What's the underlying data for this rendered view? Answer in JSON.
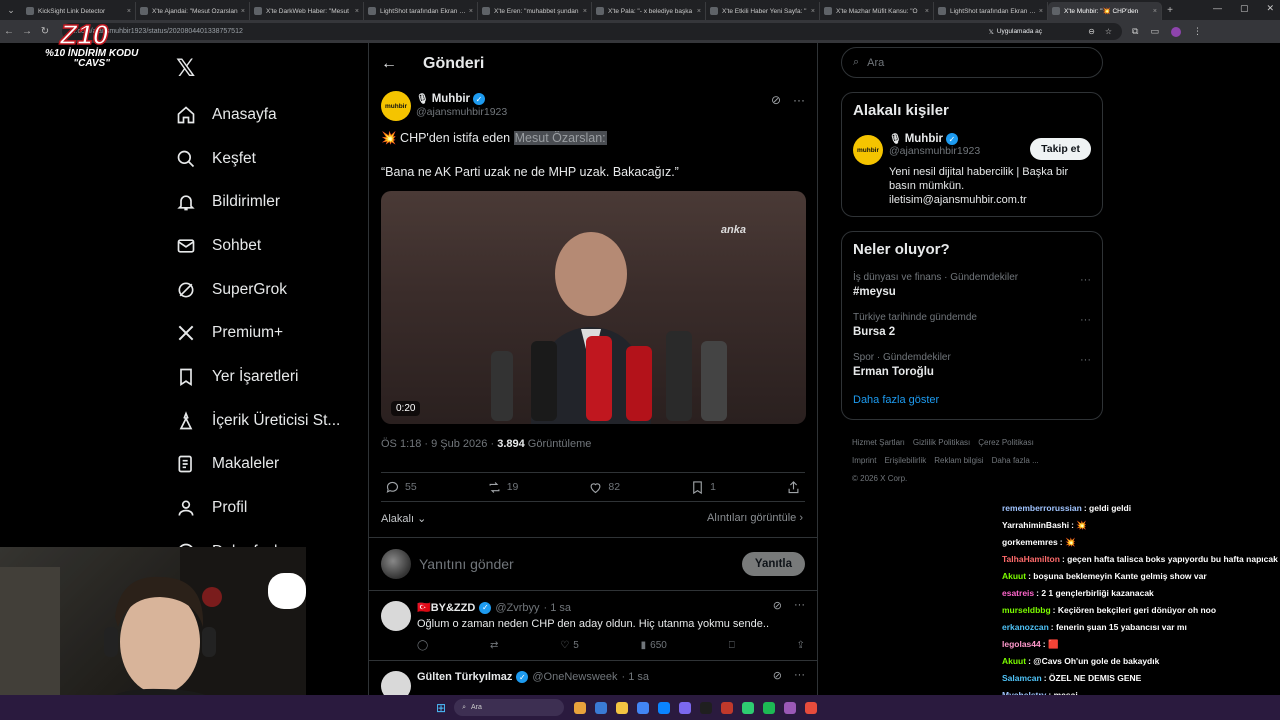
{
  "browser": {
    "tabs": [
      {
        "label": "KickSight Link Detector",
        "active": false
      },
      {
        "label": "X'te Ajandai: \"Mesut Özarslan",
        "active": false
      },
      {
        "label": "X'te DarkWeb Haber: \"Mesut",
        "active": false
      },
      {
        "label": "LightShot tarafından Ekran Gö",
        "active": false
      },
      {
        "label": "X'te Eren: \"muhabbet şundan",
        "active": false
      },
      {
        "label": "X'te Pala: \"- x belediye başka",
        "active": false
      },
      {
        "label": "X'te Etkili Haber Yeni Sayfa: \"",
        "active": false
      },
      {
        "label": "X'te Mazhar Müfit Kansu: \"Ö",
        "active": false
      },
      {
        "label": "LightShot tarafından Ekran Gö",
        "active": false
      },
      {
        "label": "X'te Muhbir: \"💥 CHP'den",
        "active": true
      }
    ],
    "url": "x.com/ajansmuhbir1923/status/2020804401338757512",
    "app_chip": "Uygulamada aç"
  },
  "stream": {
    "logo": "Z10",
    "promo_line1": "%10 İNDİRİM KODU",
    "promo_line2": "\"CAVS\""
  },
  "nav": {
    "items": [
      {
        "label": "Anasayfa",
        "icon": "home-icon"
      },
      {
        "label": "Keşfet",
        "icon": "search-icon"
      },
      {
        "label": "Bildirimler",
        "icon": "bell-icon"
      },
      {
        "label": "Sohbet",
        "icon": "mail-icon"
      },
      {
        "label": "SuperGrok",
        "icon": "grok-icon"
      },
      {
        "label": "Premium+",
        "icon": "x-premium-icon"
      },
      {
        "label": "Yer İşaretleri",
        "icon": "bookmark-icon"
      },
      {
        "label": "İçerik Üreticisi St...",
        "icon": "creator-studio-icon"
      },
      {
        "label": "Makaleler",
        "icon": "articles-icon"
      },
      {
        "label": "Profil",
        "icon": "profile-icon"
      },
      {
        "label": "Daha fazla",
        "icon": "more-circle-icon"
      }
    ]
  },
  "main": {
    "header_title": "Gönderi",
    "post": {
      "author_name": "Muhbir",
      "author_handle": "@ajansmuhbir1923",
      "avatar_text": "muhbir",
      "text_prefix": "💥 CHP'den istifa eden",
      "text_highlight": "Mesut Özarslan:",
      "quote": "“Bana ne AK Parti uzak ne de MHP uzak. Bakacağız.”",
      "video_duration": "0:20",
      "video_brand": "anka",
      "time": "ÖS 1:18 · 9 Şub 2026 ·",
      "views": "3.894",
      "views_label": "Görüntüleme",
      "replies": "55",
      "reposts": "19",
      "likes": "82",
      "bookmarks": "1",
      "sort_label": "Alakalı",
      "quotes_link": "Alıntıları görüntüle"
    },
    "reply_box": {
      "placeholder": "Yanıtını gönder",
      "button": "Yanıtla"
    },
    "replies": [
      {
        "name": "🇹🇷BY&ZZD",
        "handle": "@Zvrbyy",
        "time": "· 1 sa",
        "text": "Oğlum o zaman neden CHP den aday oldun. Hiç utanma yokmu sende..",
        "reposts": "",
        "likes": "5",
        "views": "650"
      },
      {
        "name": "Gülten Türkyılmaz",
        "handle": "@OneNewsweek",
        "time": "· 1 sa",
        "text": "",
        "reposts": "",
        "likes": "",
        "views": ""
      }
    ]
  },
  "right": {
    "search_placeholder": "Ara",
    "related_title": "Alakalı kişiler",
    "related_user": {
      "name": "Muhbir",
      "handle": "@ajansmuhbir1923",
      "follow_label": "Takip et",
      "bio": "Yeni nesil dijital habercilik | Başka bir basın mümkün. iletisim@ajansmuhbir.com.tr"
    },
    "trends_title": "Neler oluyor?",
    "trends": [
      {
        "category": "İş dünyası ve finans · Gündemdekiler",
        "title": "#meysu"
      },
      {
        "category": "Türkiye tarihinde gündemde",
        "title": "Bursa 2"
      },
      {
        "category": "Spor · Gündemdekiler",
        "title": "Erman Toroğlu"
      }
    ],
    "show_more": "Daha fazla göster",
    "footer": [
      "Hizmet Şartları",
      "Gizlilik Politikası",
      "Çerez Politikası",
      "Imprint",
      "Erişilebilirlik",
      "Reklam bilgisi",
      "Daha fazla ...",
      "© 2026 X Corp."
    ]
  },
  "chat": [
    {
      "user": "rememberrorussian",
      "color": "#a0c4ff",
      "msg": ": geldi geldi"
    },
    {
      "user": "YarrahiminBashi",
      "color": "#ffffff",
      "msg": ": 💥"
    },
    {
      "user": "gorkememres",
      "color": "#ffffff",
      "msg": ": 💥"
    },
    {
      "user": "TalhaHamilton",
      "color": "#ff6b6b",
      "msg": ": geçen hafta talisca boks yapıyordu bu hafta napıcak acaba"
    },
    {
      "user": "Akuut",
      "color": "#7cfc00",
      "msg": ": boşuna beklemeyin Kante gelmiş show var"
    },
    {
      "user": "esatreis",
      "color": "#ff66cc",
      "msg": ": 2 1 gençlerbirliği kazanacak"
    },
    {
      "user": "murseldbbg",
      "color": "#7cfc00",
      "msg": ": Keçiören bekçileri geri dönüyor oh noo"
    },
    {
      "user": "erkanozcan",
      "color": "#4fc3f7",
      "msg": ": fenerin şuan 15 yabancısı var mı"
    },
    {
      "user": "legolas44",
      "color": "#ff99cc",
      "msg": ": 🟥"
    },
    {
      "user": "Akuut",
      "color": "#7cfc00",
      "msg": ": @Cavs Oh'un gole de bakaydık"
    },
    {
      "user": "Salamcan",
      "color": "#4fc3f7",
      "msg": ": ÖZEL NE DEMIS GENE"
    },
    {
      "user": "Mychelstry",
      "color": "#a0c4ff",
      "msg": ": mesaj"
    }
  ],
  "taskbar": {
    "search_placeholder": "Ara"
  }
}
